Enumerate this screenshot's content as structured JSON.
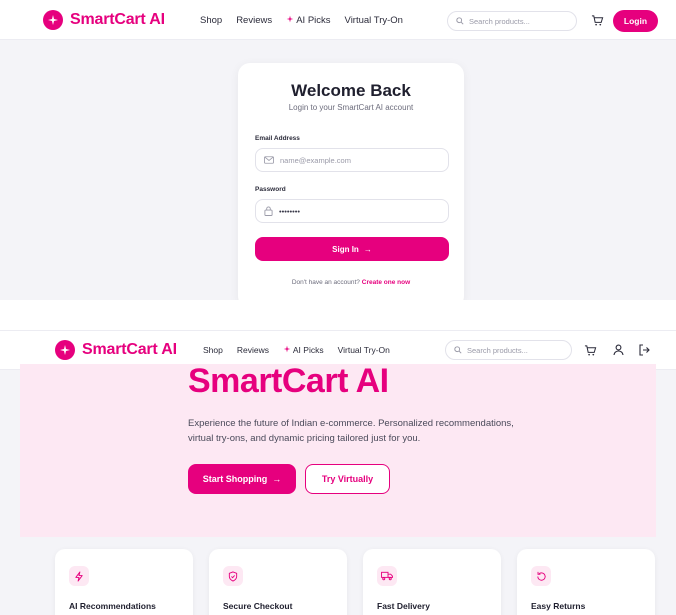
{
  "brand": {
    "name": "SmartCart AI",
    "color": "#e6007e"
  },
  "nav": {
    "links": [
      {
        "label": "Shop"
      },
      {
        "label": "Reviews"
      },
      {
        "label": "AI Picks"
      },
      {
        "label": "Virtual Try-On"
      }
    ],
    "search_placeholder": "Search products...",
    "login_label": "Login"
  },
  "login": {
    "title": "Welcome Back",
    "subtitle": "Login to your SmartCart AI account",
    "email_label": "Email Address",
    "email_placeholder": "name@example.com",
    "password_label": "Password",
    "password_value": "••••••••",
    "submit_label": "Sign In",
    "signup_prompt": "Don't have an account?",
    "signup_link": "Create one now"
  },
  "hero": {
    "title": "SmartCart AI",
    "description": "Experience the future of Indian e-commerce. Personalized recommendations, virtual try-ons, and dynamic pricing tailored just for you.",
    "primary_button": "Start Shopping",
    "secondary_button": "Try Virtually"
  },
  "features": [
    {
      "title": "AI Recommendations",
      "icon": "zap-icon"
    },
    {
      "title": "Secure Checkout",
      "icon": "shield-check-icon"
    },
    {
      "title": "Fast Delivery",
      "icon": "truck-icon"
    },
    {
      "title": "Easy Returns",
      "icon": "rotate-icon"
    }
  ]
}
